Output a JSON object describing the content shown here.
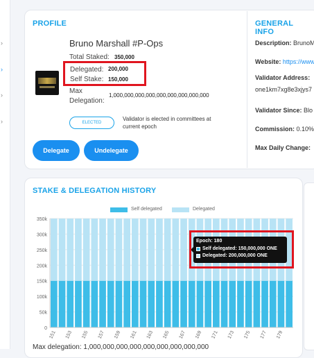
{
  "profile": {
    "title": "PROFILE",
    "validator_name": "Bruno Marshall #P-Ops",
    "total_staked_label": "Total Staked:",
    "total_staked_value": "350,000",
    "delegated_label": "Delegated:",
    "delegated_value": "200,000",
    "self_stake_label": "Self Stake:",
    "self_stake_value": "150,000",
    "max_delegation_label_1": "Max",
    "max_delegation_label_2": "Delegation:",
    "max_delegation_value": "1,000,000,000,000,000,000,000,000,000",
    "elected_badge": "ELECTED",
    "elected_note": "Validator is elected in committees at current epoch",
    "delegate_button": "Delegate",
    "undelegate_button": "Undelegate"
  },
  "general_info": {
    "title": "GENERAL INFO",
    "description_label": "Description:",
    "description_value": "BrunoM",
    "website_label": "Website:",
    "website_value": "https://www",
    "validator_address_label": "Validator Address:",
    "validator_address_value": "one1km7xg8e3xjys7",
    "validator_since_label": "Validator Since:",
    "validator_since_value": "Blo",
    "commission_label": "Commission:",
    "commission_value": "0.10%",
    "max_daily_change_label": "Max Daily Change:"
  },
  "history": {
    "title": "STAKE & DELEGATION HISTORY",
    "max_delegation_text": "Max delegation: 1,000,000,000,000,000,000,000,000,000"
  },
  "tooltip": {
    "epoch": "Epoch: 180",
    "self_delegated": "Self delegated: 150,000,000 ONE",
    "delegated": "Delegated: 200,000,000 ONE"
  },
  "colors": {
    "self_delegated": "#3ebde8",
    "delegated": "#b8e3f5",
    "accent": "#1a8ff0",
    "highlight_box": "#e0151f"
  },
  "chart_data": {
    "type": "bar",
    "stacked": true,
    "legend_position": "top",
    "grid": true,
    "ylim": [
      0,
      350000
    ],
    "y_ticks": [
      "0",
      "50k",
      "100k",
      "150k",
      "200k",
      "250k",
      "300k",
      "350k"
    ],
    "categories": [
      "151",
      "152",
      "153",
      "154",
      "155",
      "156",
      "157",
      "158",
      "159",
      "160",
      "161",
      "162",
      "163",
      "164",
      "165",
      "166",
      "167",
      "168",
      "169",
      "170",
      "171",
      "172",
      "173",
      "174",
      "175",
      "176",
      "177",
      "178",
      "179",
      "180"
    ],
    "x_tick_labels": [
      "151",
      "153",
      "155",
      "157",
      "159",
      "161",
      "163",
      "165",
      "167",
      "169",
      "171",
      "173",
      "175",
      "177",
      "179"
    ],
    "series": [
      {
        "name": "Self delegated",
        "color": "#3ebde8",
        "values": [
          150000,
          150000,
          150000,
          150000,
          150000,
          150000,
          150000,
          150000,
          150000,
          150000,
          150000,
          150000,
          150000,
          150000,
          150000,
          150000,
          150000,
          150000,
          150000,
          150000,
          150000,
          150000,
          150000,
          150000,
          150000,
          150000,
          150000,
          150000,
          150000,
          150000
        ]
      },
      {
        "name": "Delegated",
        "color": "#b8e3f5",
        "values": [
          200000,
          200000,
          200000,
          200000,
          200000,
          200000,
          200000,
          200000,
          200000,
          200000,
          200000,
          200000,
          200000,
          200000,
          200000,
          200000,
          200000,
          200000,
          200000,
          200000,
          200000,
          200000,
          200000,
          200000,
          200000,
          200000,
          200000,
          200000,
          200000,
          200000
        ]
      }
    ]
  }
}
